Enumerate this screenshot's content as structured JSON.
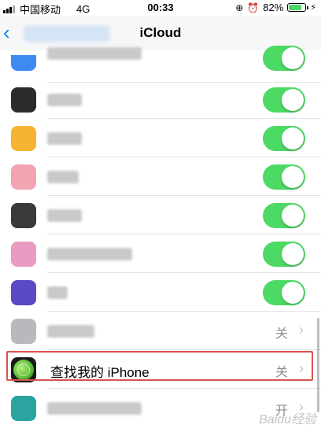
{
  "status_bar": {
    "carrier": "中国移动",
    "network": "4G",
    "time": "00:33",
    "battery_percent": "82%",
    "battery_level": 0.82,
    "icons": [
      "signal-icon",
      "orientation-lock-icon",
      "alarm-icon",
      "battery-icon",
      "charging-icon"
    ]
  },
  "nav": {
    "title": "iCloud",
    "back_icon": "chevron-left-icon"
  },
  "rows": [
    {
      "toggle": true,
      "icon_color": "#3d8bf2"
    },
    {
      "toggle": true,
      "icon_color": "#2b2b2e"
    },
    {
      "toggle": true,
      "icon_color": "#f5b533"
    },
    {
      "toggle": true,
      "icon_color": "#f3a4b2"
    },
    {
      "toggle": true,
      "icon_color": "#3a3a3a"
    },
    {
      "toggle": true,
      "icon_color": "#e99bc1"
    },
    {
      "toggle": true,
      "icon_color": "#5a4ac6"
    },
    {
      "value": "关",
      "icon_color": "#b9b9bd"
    },
    {
      "label": "查找我的 iPhone",
      "value": "关",
      "icon_color": "#3fae3a"
    },
    {
      "value": "开",
      "icon_color": "#2aa3a1"
    }
  ],
  "colors": {
    "toggle_on": "#4cd964",
    "accent": "#0a7cff",
    "highlight_border": "#d9534f"
  },
  "watermark": "Baidu经验"
}
